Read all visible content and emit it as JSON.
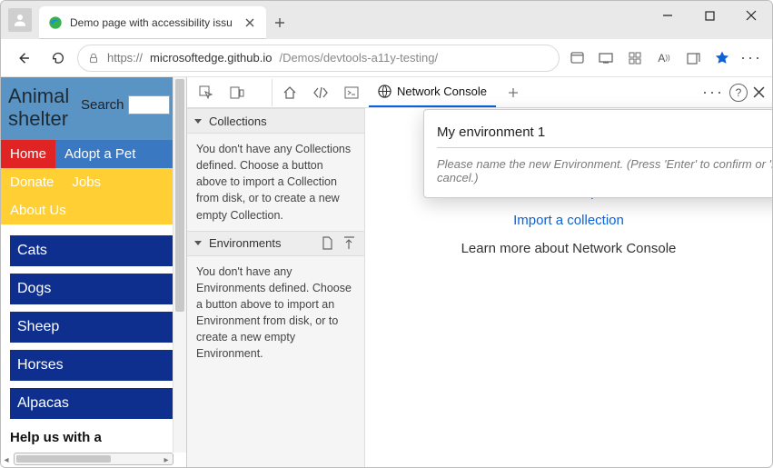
{
  "window": {
    "tab_title": "Demo page with accessibility issu",
    "url_host": "microsoftedge.github.io",
    "url_scheme": "https://",
    "url_path": "/Demos/devtools-a11y-testing/"
  },
  "page": {
    "site_title_line1": "Animal",
    "site_title_line2": "shelter",
    "search_label": "Search",
    "nav": [
      "Home",
      "Adopt a Pet",
      "Donate",
      "Jobs",
      "About Us"
    ],
    "animals": [
      "Cats",
      "Dogs",
      "Sheep",
      "Horses",
      "Alpacas"
    ],
    "help_heading": "Help us with a"
  },
  "devtools": {
    "active_tab": "Network Console",
    "collections": {
      "header": "Collections",
      "empty_visible": "You don't have any Collections defined. Choose a button above to import a Collection from disk, or to create a new empty Collection."
    },
    "environments": {
      "header": "Environments",
      "empty": "You don't have any Environments defined. Choose a button above to import an Environment from disk, or to create a new empty Environment."
    },
    "main_links": {
      "create": "Create a request",
      "import": "Import a collection",
      "learn": "Learn more about Network Console"
    },
    "popup": {
      "value": "My environment 1",
      "hint": "Please name the new Environment. (Press 'Enter' to confirm or 'Escape' to cancel.)"
    }
  }
}
